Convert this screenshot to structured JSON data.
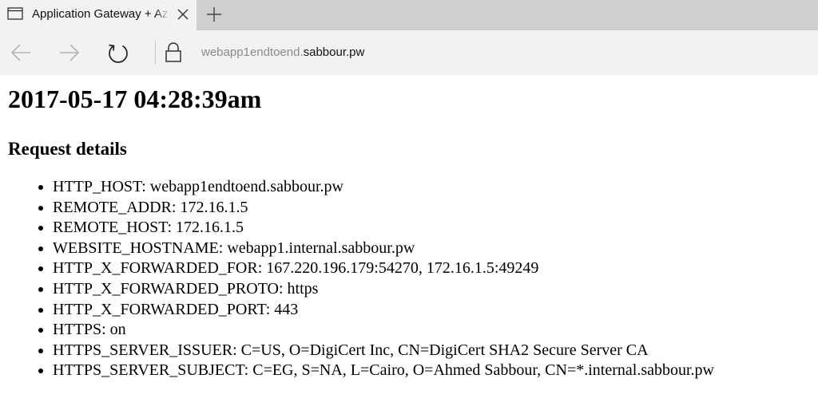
{
  "browser": {
    "tab": {
      "title": "Application Gateway + Azure Web Apps",
      "icon": "window-icon"
    },
    "new_tab_icon": "plus-icon",
    "close_tab_icon": "close-icon",
    "nav": {
      "back_icon": "back-arrow-icon",
      "forward_icon": "forward-arrow-icon",
      "refresh_icon": "refresh-icon",
      "lock_icon": "lock-icon"
    },
    "address": {
      "subdomain": "webapp1endtoend.",
      "domain": "sabbour.pw"
    }
  },
  "page": {
    "timestamp": "2017-05-17 04:28:39am",
    "section_title": "Request details",
    "details": [
      "HTTP_HOST: webapp1endtoend.sabbour.pw",
      "REMOTE_ADDR: 172.16.1.5",
      "REMOTE_HOST: 172.16.1.5",
      "WEBSITE_HOSTNAME: webapp1.internal.sabbour.pw",
      "HTTP_X_FORWARDED_FOR: 167.220.196.179:54270, 172.16.1.5:49249",
      "HTTP_X_FORWARDED_PROTO: https",
      "HTTP_X_FORWARDED_PORT: 443",
      "HTTPS: on",
      "HTTPS_SERVER_ISSUER: C=US, O=DigiCert Inc, CN=DigiCert SHA2 Secure Server CA",
      "HTTPS_SERVER_SUBJECT: C=EG, S=NA, L=Cairo, O=Ahmed Sabbour, CN=*.internal.sabbour.pw"
    ]
  }
}
